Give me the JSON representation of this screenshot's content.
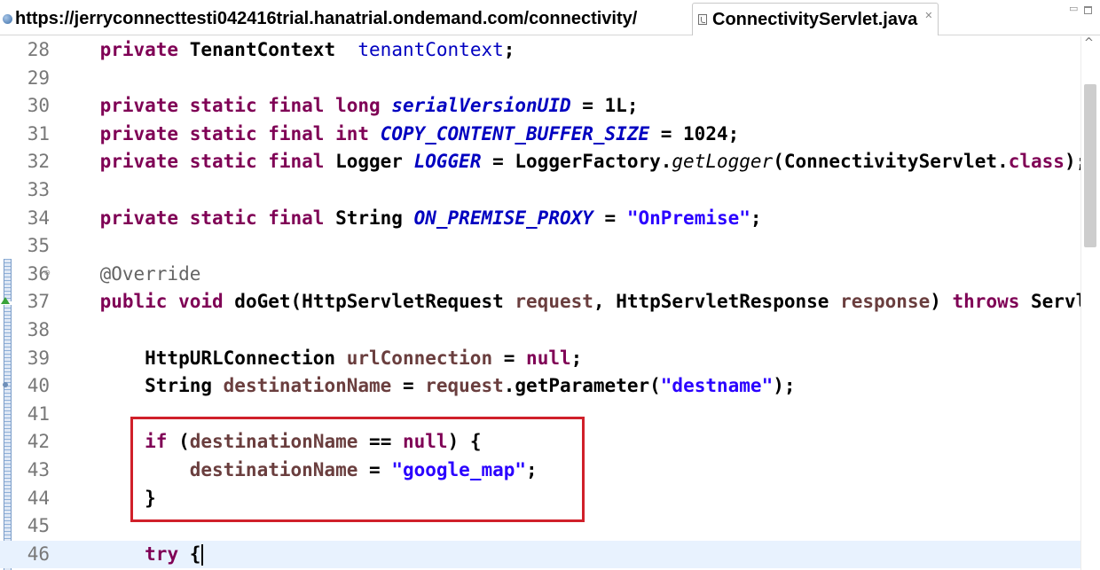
{
  "tabs": {
    "url_tab": "https://jerryconnecttesti042416trial.hanatrial.ondemand.com/connectivity/",
    "file_tab": "ConnectivityServlet.java",
    "close_glyph": "✕"
  },
  "colors": {
    "keyword": "#7f0055",
    "field": "#0000c0",
    "string": "#2a00ff",
    "local_variable": "#6a3e3e",
    "annotation": "#646464",
    "highlight_box": "#d0202a"
  },
  "code": {
    "lines": [
      {
        "no": "28",
        "fold": "",
        "tokens": [
          [
            "pl",
            "    "
          ],
          [
            "kw",
            "private"
          ],
          [
            "pl",
            " TenantContext  "
          ],
          [
            "fld",
            "tenantContext"
          ],
          [
            "pl",
            ";"
          ]
        ]
      },
      {
        "no": "29",
        "fold": "",
        "tokens": []
      },
      {
        "no": "30",
        "fold": "",
        "tokens": [
          [
            "pl",
            "    "
          ],
          [
            "kw",
            "private static final long"
          ],
          [
            "pl",
            " "
          ],
          [
            "sfld",
            "serialVersionUID"
          ],
          [
            "pl",
            " = 1L;"
          ]
        ]
      },
      {
        "no": "31",
        "fold": "",
        "tokens": [
          [
            "pl",
            "    "
          ],
          [
            "kw",
            "private static final int"
          ],
          [
            "pl",
            " "
          ],
          [
            "sfld",
            "COPY_CONTENT_BUFFER_SIZE"
          ],
          [
            "pl",
            " = 1024;"
          ]
        ]
      },
      {
        "no": "32",
        "fold": "",
        "tokens": [
          [
            "pl",
            "    "
          ],
          [
            "kw",
            "private static final"
          ],
          [
            "pl",
            " Logger "
          ],
          [
            "sfld",
            "LOGGER"
          ],
          [
            "pl",
            " = LoggerFactory."
          ],
          [
            "smeth",
            "getLogger"
          ],
          [
            "pl",
            "(ConnectivityServlet."
          ],
          [
            "kw",
            "class"
          ],
          [
            "pl",
            ");"
          ]
        ]
      },
      {
        "no": "33",
        "fold": "",
        "tokens": []
      },
      {
        "no": "34",
        "fold": "",
        "tokens": [
          [
            "pl",
            "    "
          ],
          [
            "kw",
            "private static final"
          ],
          [
            "pl",
            " String "
          ],
          [
            "sfld",
            "ON_PREMISE_PROXY"
          ],
          [
            "pl",
            " = "
          ],
          [
            "str",
            "\"OnPremise\""
          ],
          [
            "pl",
            ";"
          ]
        ]
      },
      {
        "no": "35",
        "fold": "",
        "tokens": []
      },
      {
        "no": "36",
        "fold": "⊖",
        "tokens": [
          [
            "pl",
            "    "
          ],
          [
            "ann",
            "@Override"
          ]
        ]
      },
      {
        "no": "37",
        "fold": "",
        "tokens": [
          [
            "pl",
            "    "
          ],
          [
            "kw",
            "public void"
          ],
          [
            "pl",
            " doGet(HttpServletRequest "
          ],
          [
            "var",
            "request"
          ],
          [
            "pl",
            ", HttpServletResponse "
          ],
          [
            "var",
            "response"
          ],
          [
            "pl",
            ") "
          ],
          [
            "kw",
            "throws"
          ],
          [
            "pl",
            " ServletException, IOException {"
          ]
        ]
      },
      {
        "no": "38",
        "fold": "",
        "tokens": []
      },
      {
        "no": "39",
        "fold": "",
        "tokens": [
          [
            "pl",
            "        HttpURLConnection "
          ],
          [
            "var",
            "urlConnection"
          ],
          [
            "pl",
            " = "
          ],
          [
            "kw",
            "null"
          ],
          [
            "pl",
            ";"
          ]
        ]
      },
      {
        "no": "40",
        "fold": "",
        "tokens": [
          [
            "pl",
            "        String "
          ],
          [
            "var",
            "destinationName"
          ],
          [
            "pl",
            " = "
          ],
          [
            "var",
            "request"
          ],
          [
            "pl",
            ".getParameter("
          ],
          [
            "str",
            "\"destname\""
          ],
          [
            "pl",
            ");"
          ]
        ]
      },
      {
        "no": "41",
        "fold": "",
        "tokens": []
      },
      {
        "no": "42",
        "fold": "",
        "tokens": [
          [
            "pl",
            "        "
          ],
          [
            "kw",
            "if"
          ],
          [
            "pl",
            " ("
          ],
          [
            "var",
            "destinationName"
          ],
          [
            "pl",
            " == "
          ],
          [
            "kw",
            "null"
          ],
          [
            "pl",
            ") {"
          ]
        ]
      },
      {
        "no": "43",
        "fold": "",
        "tokens": [
          [
            "pl",
            "            "
          ],
          [
            "var",
            "destinationName"
          ],
          [
            "pl",
            " = "
          ],
          [
            "str",
            "\"google_map\""
          ],
          [
            "pl",
            ";"
          ]
        ]
      },
      {
        "no": "44",
        "fold": "",
        "tokens": [
          [
            "pl",
            "        }"
          ]
        ]
      },
      {
        "no": "45",
        "fold": "",
        "tokens": []
      },
      {
        "no": "46",
        "fold": "",
        "tokens": [
          [
            "pl",
            "        "
          ],
          [
            "kw",
            "try"
          ],
          [
            "pl",
            " {"
          ]
        ]
      }
    ],
    "current_line": "46"
  }
}
